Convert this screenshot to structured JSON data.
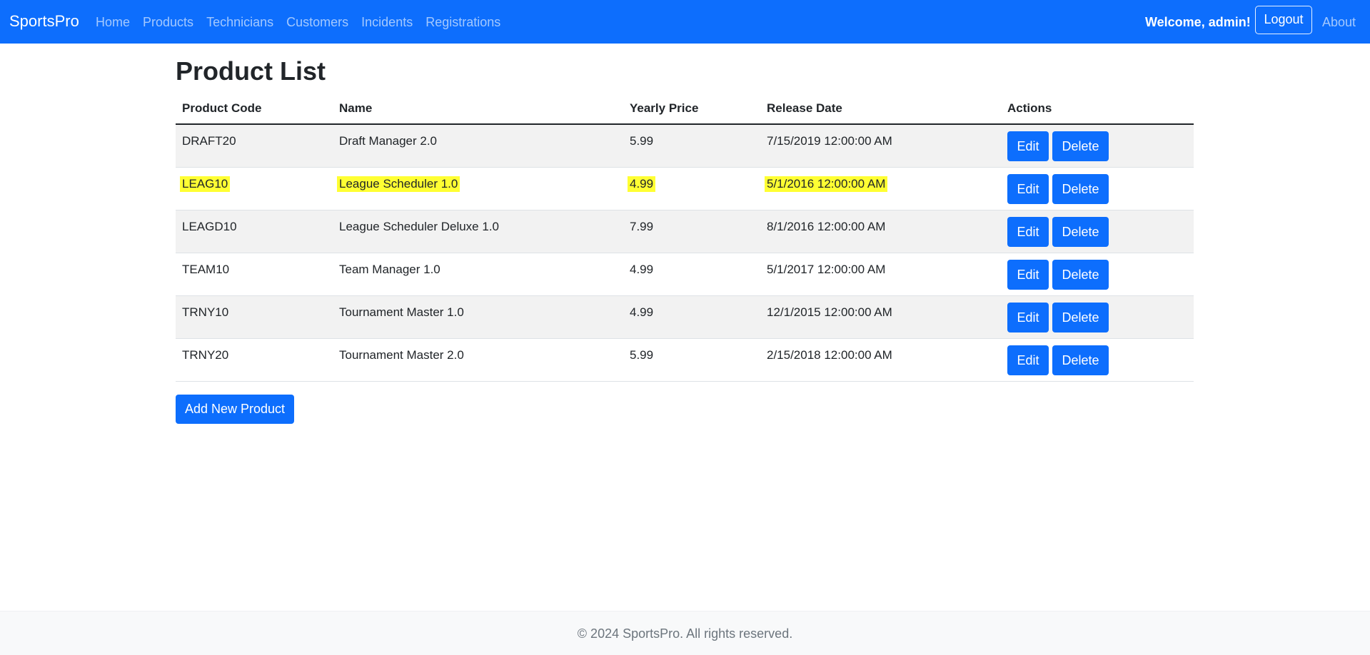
{
  "nav": {
    "brand": "SportsPro",
    "links": [
      "Home",
      "Products",
      "Technicians",
      "Customers",
      "Incidents",
      "Registrations"
    ],
    "welcome": "Welcome, admin!",
    "logout": "Logout",
    "about": "About"
  },
  "page": {
    "title": "Product List"
  },
  "table": {
    "headers": [
      "Product Code",
      "Name",
      "Yearly Price",
      "Release Date",
      "Actions"
    ],
    "rows": [
      {
        "code": "DRAFT20",
        "name": "Draft Manager 2.0",
        "price": "5.99",
        "date": "7/15/2019 12:00:00 AM"
      },
      {
        "code": "LEAG10",
        "name": "League Scheduler 1.0",
        "price": "4.99",
        "date": "5/1/2016 12:00:00 AM",
        "highlighted": true
      },
      {
        "code": "LEAGD10",
        "name": "League Scheduler Deluxe 1.0",
        "price": "7.99",
        "date": "8/1/2016 12:00:00 AM"
      },
      {
        "code": "TEAM10",
        "name": "Team Manager 1.0",
        "price": "4.99",
        "date": "5/1/2017 12:00:00 AM"
      },
      {
        "code": "TRNY10",
        "name": "Tournament Master 1.0",
        "price": "4.99",
        "date": "12/1/2015 12:00:00 AM"
      },
      {
        "code": "TRNY20",
        "name": "Tournament Master 2.0",
        "price": "5.99",
        "date": "2/15/2018 12:00:00 AM"
      }
    ],
    "edit_label": "Edit",
    "delete_label": "Delete"
  },
  "add_button": "Add New Product",
  "footer": {
    "text": "© 2024 SportsPro. All rights reserved."
  },
  "colors": {
    "primary": "#0d6efd",
    "highlight": "#ffff33",
    "stripe": "#f2f2f2"
  }
}
